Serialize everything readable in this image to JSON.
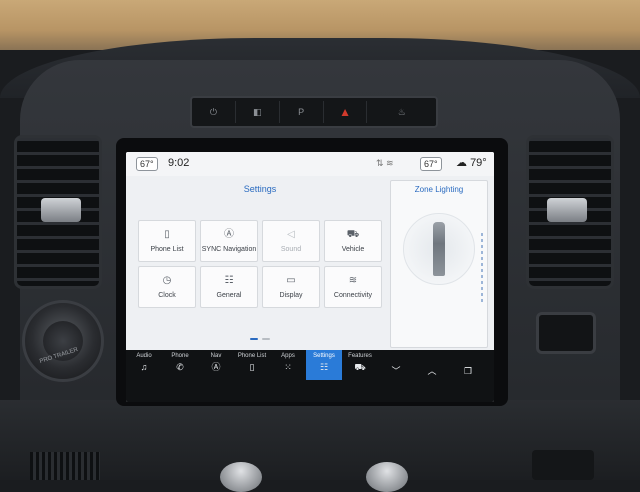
{
  "hard_buttons": [
    {
      "icon": "power-icon",
      "glyph": "⏻"
    },
    {
      "icon": "camera-icon",
      "glyph": "◧"
    },
    {
      "icon": "parking-icon",
      "glyph": "P"
    },
    {
      "icon": "hazard-icon",
      "glyph": "▲"
    },
    {
      "icon": "defrost-icon",
      "glyph": "♨"
    }
  ],
  "status": {
    "cabin_temp_left": "67°",
    "time": "9:02",
    "cabin_temp_right": "67°",
    "outside_temp": "79°"
  },
  "settings": {
    "title": "Settings",
    "tiles": [
      {
        "label": "Phone List",
        "icon": "phone-list-icon",
        "glyph": "▯",
        "enabled": true
      },
      {
        "label": "SYNC Navigation",
        "icon": "navigation-icon",
        "glyph": "Ⓐ",
        "enabled": true
      },
      {
        "label": "Sound",
        "icon": "speaker-icon",
        "glyph": "◁",
        "enabled": false
      },
      {
        "label": "Vehicle",
        "icon": "vehicle-icon",
        "glyph": "⛟",
        "enabled": true
      },
      {
        "label": "Clock",
        "icon": "clock-icon",
        "glyph": "◷",
        "enabled": true
      },
      {
        "label": "General",
        "icon": "sliders-icon",
        "glyph": "☷",
        "enabled": true
      },
      {
        "label": "Display",
        "icon": "display-icon",
        "glyph": "▭",
        "enabled": true
      },
      {
        "label": "Connectivity",
        "icon": "wifi-icon",
        "glyph": "≋",
        "enabled": true
      }
    ]
  },
  "zone_lighting": {
    "title": "Zone Lighting"
  },
  "nav": [
    {
      "label": "Audio",
      "icon": "music-icon",
      "glyph": "♫",
      "active": false
    },
    {
      "label": "Phone",
      "icon": "phone-icon",
      "glyph": "✆",
      "active": false
    },
    {
      "label": "Nav",
      "icon": "nav-icon",
      "glyph": "Ⓐ",
      "active": false
    },
    {
      "label": "Phone List",
      "icon": "phone-list-icon",
      "glyph": "▯",
      "active": false
    },
    {
      "label": "Apps",
      "icon": "apps-grid-icon",
      "glyph": "⁙",
      "active": false
    },
    {
      "label": "Settings",
      "icon": "settings-icon",
      "glyph": "☷",
      "active": true
    },
    {
      "label": "Features",
      "icon": "truck-icon",
      "glyph": "⛟",
      "active": false
    },
    {
      "label": "",
      "icon": "chevron-down-icon",
      "glyph": "﹀",
      "active": false
    },
    {
      "label": "",
      "icon": "chevron-up-icon",
      "glyph": "︿",
      "active": false
    },
    {
      "label": "",
      "icon": "copy-icon",
      "glyph": "❐",
      "active": false
    }
  ],
  "dial_label": "PRO TRAILER"
}
